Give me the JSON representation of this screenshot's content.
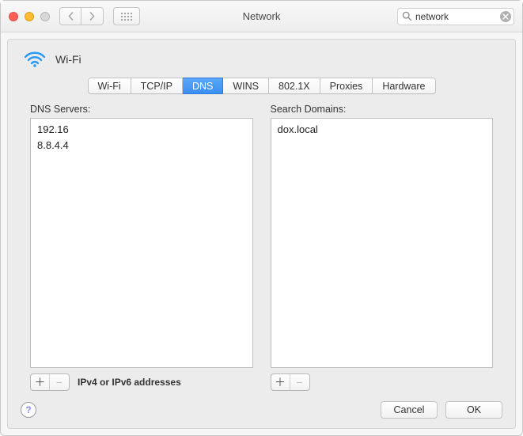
{
  "window": {
    "title": "Network",
    "search_value": "network"
  },
  "service": {
    "name": "Wi-Fi"
  },
  "tabs": [
    {
      "id": "wifi",
      "label": "Wi-Fi",
      "active": false
    },
    {
      "id": "tcpip",
      "label": "TCP/IP",
      "active": false
    },
    {
      "id": "dns",
      "label": "DNS",
      "active": true
    },
    {
      "id": "wins",
      "label": "WINS",
      "active": false
    },
    {
      "id": "8021x",
      "label": "802.1X",
      "active": false
    },
    {
      "id": "proxies",
      "label": "Proxies",
      "active": false
    },
    {
      "id": "hardware",
      "label": "Hardware",
      "active": false
    }
  ],
  "dns": {
    "label": "DNS Servers:",
    "items": [
      "192.16",
      "8.8.4.4"
    ],
    "hint": "IPv4 or IPv6 addresses"
  },
  "domains": {
    "label": "Search Domains:",
    "items": [
      "dox.local"
    ]
  },
  "buttons": {
    "cancel": "Cancel",
    "ok": "OK"
  }
}
